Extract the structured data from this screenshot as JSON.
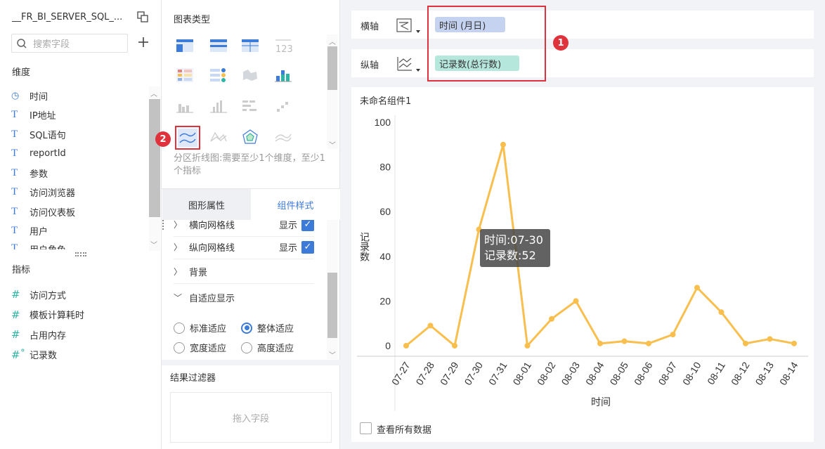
{
  "left_panel": {
    "dataset_name": "__FR_BI_SERVER_SQL_...",
    "search_placeholder": "搜索字段",
    "dimension_title": "维度",
    "dimensions": [
      "时间",
      "IP地址",
      "SQL语句",
      "reportId",
      "参数",
      "访问浏览器",
      "访问仪表板",
      "用户",
      "用户角色"
    ],
    "metric_title": "指标",
    "metrics": [
      "访问方式",
      "模板计算耗时",
      "占用内存",
      "记录数"
    ]
  },
  "middle_panel": {
    "chart_type_title": "图表类型",
    "hint_text": "分区折线图:需要至少1个维度，至少1个指标",
    "tab_graphic": "图形属性",
    "tab_component": "组件样式",
    "rows": {
      "h_grid": "横向网格线",
      "v_grid": "纵向网格线",
      "show1": "显示",
      "show2": "显示",
      "background": "背景",
      "adaptive": "自适应显示"
    },
    "radios": {
      "standard": "标准适应",
      "whole": "整体适应",
      "width": "宽度适应",
      "height": "高度适应",
      "selected": "整体适应"
    },
    "filter_title": "结果过滤器",
    "filter_placeholder": "拖入字段"
  },
  "right_panel": {
    "x_axis_label": "横轴",
    "y_axis_label": "纵轴",
    "x_field": "时间 (月日)",
    "y_field": "记录数(总行数)",
    "badge1": "1",
    "badge2": "2",
    "widget_title": "未命名组件1",
    "view_all_label": "查看所有数据",
    "tooltip_line1": "时间:07-30",
    "tooltip_line2": "记录数:52"
  },
  "colors": {
    "accent": "#3d7bd9",
    "line": "#f8bf4f",
    "x_pill": "#c5d3f0",
    "y_pill": "#b6e7dc",
    "highlight": "#e0323c"
  },
  "chart_data": {
    "type": "line",
    "categories": [
      "07-27",
      "07-28",
      "07-29",
      "07-30",
      "07-31",
      "08-01",
      "08-02",
      "08-03",
      "08-04",
      "08-05",
      "08-06",
      "08-07",
      "08-10",
      "08-11",
      "08-12",
      "08-13",
      "08-14"
    ],
    "values": [
      0,
      9,
      0,
      52,
      90,
      0,
      12,
      20,
      1,
      2,
      1,
      5,
      26,
      15,
      1,
      3,
      1
    ],
    "xlabel": "时间",
    "ylabel": "记录数",
    "ylim": [
      0,
      100
    ],
    "yticks": [
      0,
      20,
      40,
      60,
      80,
      100
    ]
  }
}
